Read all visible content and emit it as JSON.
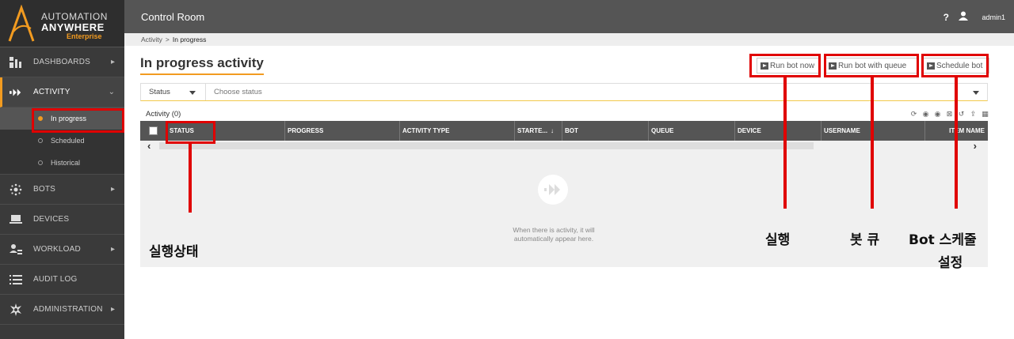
{
  "brand": {
    "line1": "AUTOMATION",
    "line2": "ANYWHERE",
    "line3": "Enterprise",
    "accent": "#f29b20"
  },
  "sidebar": {
    "items": [
      {
        "label": "DASHBOARDS",
        "icon": "dashboard-icon"
      },
      {
        "label": "ACTIVITY",
        "icon": "activity-icon"
      },
      {
        "label": "BOTS",
        "icon": "bots-icon"
      },
      {
        "label": "DEVICES",
        "icon": "devices-icon"
      },
      {
        "label": "WORKLOAD",
        "icon": "workload-icon"
      },
      {
        "label": "AUDIT LOG",
        "icon": "audit-log-icon"
      },
      {
        "label": "ADMINISTRATION",
        "icon": "administration-icon"
      }
    ],
    "activity_sub": [
      "In progress",
      "Scheduled",
      "Historical"
    ]
  },
  "topbar": {
    "title": "Control Room",
    "help": "?",
    "user": "admin1"
  },
  "breadcrumb": {
    "parent": "Activity",
    "separator": ">",
    "current": "In progress"
  },
  "page": {
    "title": "In progress activity"
  },
  "actions": {
    "run_now": "Run bot now",
    "run_queue": "Run bot with queue",
    "schedule": "Schedule bot"
  },
  "filter": {
    "field": "Status",
    "placeholder": "Choose status"
  },
  "table": {
    "count_label": "Activity (0)",
    "columns": [
      "STATUS",
      "PROGRESS",
      "ACTIVITY TYPE",
      "STARTE...",
      "BOT",
      "QUEUE",
      "DEVICE",
      "USERNAME",
      "ITEM NAME"
    ],
    "sort_indicator": "↓",
    "empty_message": "When there is activity, it will automatically appear here."
  },
  "annotations": {
    "status": "실행상태",
    "run": "실행",
    "queue": "봇 큐",
    "schedule_line1": "Bot 스케줄",
    "schedule_line2": "설정",
    "color": "#e00000"
  }
}
